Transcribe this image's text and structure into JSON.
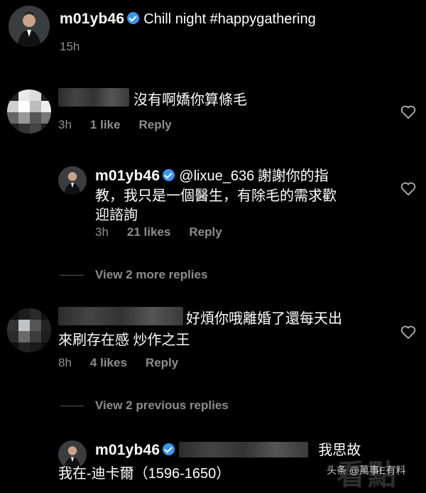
{
  "post": {
    "username": "m01yb46",
    "caption": "Chill night #happygathering",
    "time": "15h"
  },
  "comments": [
    {
      "username_redacted": true,
      "text": "沒有啊嬌你算條毛",
      "time": "3h",
      "likes": "1 like",
      "reply_label": "Reply",
      "heart_icon": "heart-outline-icon"
    },
    {
      "username": "m01yb46",
      "mention": "@lixue_636",
      "text_line1": "謝謝你的指",
      "text_line2": "教，我只是一個醫生，有除毛的需求歡",
      "text_line3": "迎諮詢",
      "time": "3h",
      "likes": "21 likes",
      "reply_label": "Reply",
      "heart_icon": "heart-outline-icon"
    },
    {
      "view_more": "View 2 more replies"
    },
    {
      "username_redacted": true,
      "text_line1": "好煩你哦離婚了還每天出",
      "text_line2": "來刷存在感 炒作之王",
      "time": "8h",
      "likes": "4 likes",
      "reply_label": "Reply",
      "heart_icon": "heart-outline-icon"
    },
    {
      "view_previous": "View 2 previous replies"
    },
    {
      "username": "m01yb46",
      "text_line1": "我思故",
      "text_line2": "我在-迪卡爾（1596-1650）"
    }
  ],
  "watermark": {
    "small": "头条 @萬事E有料",
    "big": "看點"
  }
}
